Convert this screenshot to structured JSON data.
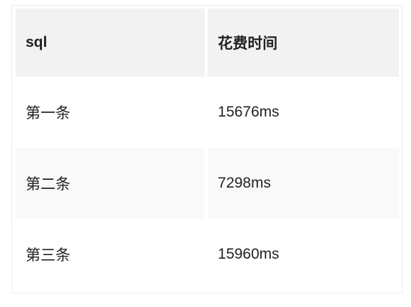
{
  "table": {
    "headers": [
      "sql",
      "花费时间"
    ],
    "rows": [
      [
        "第一条",
        "15676ms"
      ],
      [
        "第二条",
        "7298ms"
      ],
      [
        "第三条",
        "15960ms"
      ]
    ]
  }
}
